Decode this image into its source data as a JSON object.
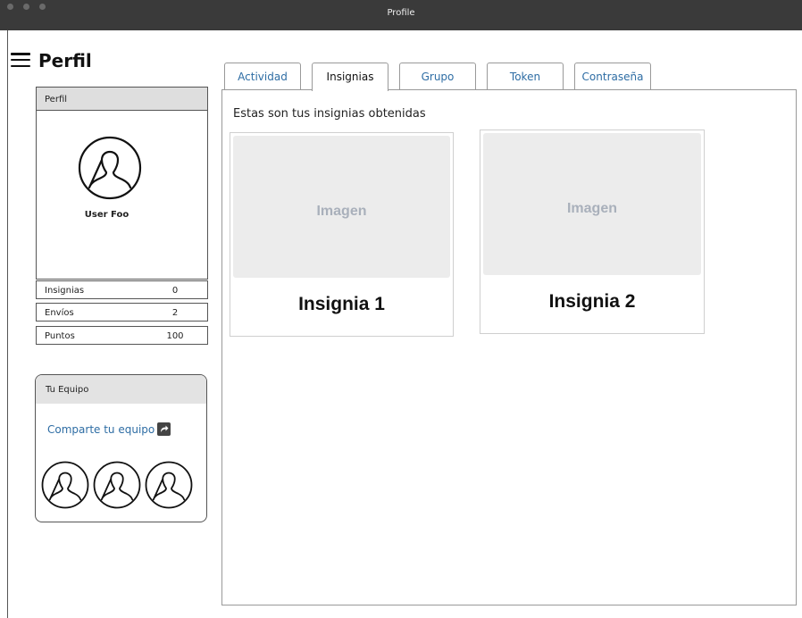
{
  "window": {
    "title": "Profile"
  },
  "header": {
    "title": "Perfil"
  },
  "profile_card": {
    "title": "Perfil",
    "user_name": "User Foo",
    "stats": [
      {
        "label": "Insignias",
        "value": "0"
      },
      {
        "label": "Envíos",
        "value": "2"
      },
      {
        "label": "Puntos",
        "value": "100"
      }
    ]
  },
  "team_card": {
    "title": "Tu Equipo",
    "share_label": "Comparte tu equipo",
    "share_icon": "share-arrow-icon",
    "member_icon": "user-avatar-icon"
  },
  "tabs": [
    {
      "label": "Actividad",
      "active": false
    },
    {
      "label": "Insignias",
      "active": true
    },
    {
      "label": "Grupo",
      "active": false
    },
    {
      "label": "Token",
      "active": false
    },
    {
      "label": "Contraseña",
      "active": false
    }
  ],
  "main": {
    "heading": "Estas son tus insignias obtenidas",
    "badges": [
      {
        "image_placeholder": "Imagen",
        "name": "Insignia 1"
      },
      {
        "image_placeholder": "Imagen",
        "name": "Insignia 2"
      }
    ]
  },
  "colors": {
    "link": "#2e6da4",
    "titlebar": "#3a3a3a",
    "header_bg": "#dedede",
    "placeholder": "#a9b0bb"
  }
}
